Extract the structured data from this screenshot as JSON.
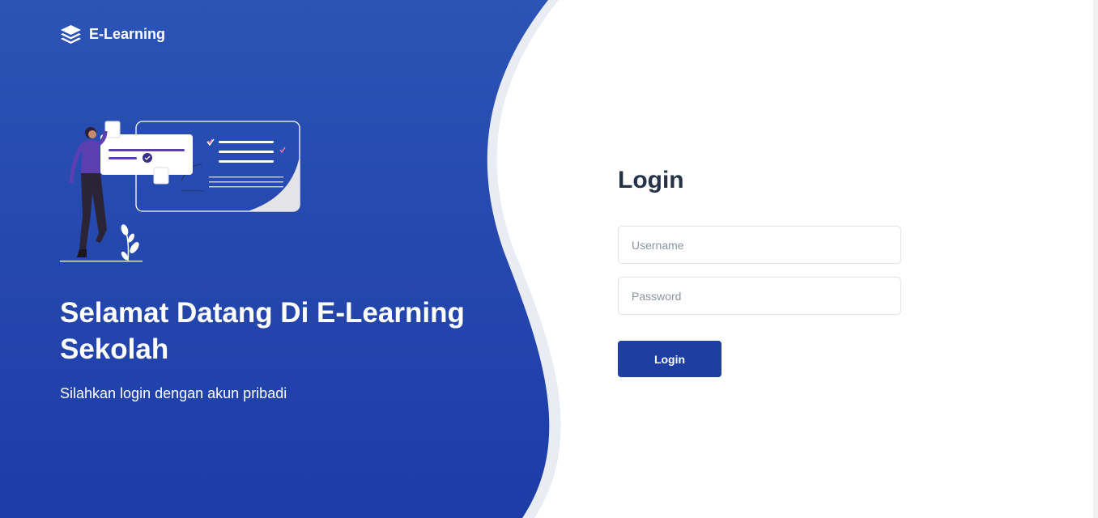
{
  "brand": {
    "name": "E-Learning",
    "icon": "layers-icon"
  },
  "hero": {
    "title": "Selamat Datang Di E-Learning Sekolah",
    "subtitle": "Silahkan login dengan akun pribadi"
  },
  "login": {
    "title": "Login",
    "username_placeholder": "Username",
    "password_placeholder": "Password",
    "button_label": "Login"
  },
  "colors": {
    "primary": "#1e3ea1",
    "panel_gradient_top": "#2c53b6",
    "panel_gradient_bottom": "#1d3da6",
    "heading": "#25324a"
  }
}
